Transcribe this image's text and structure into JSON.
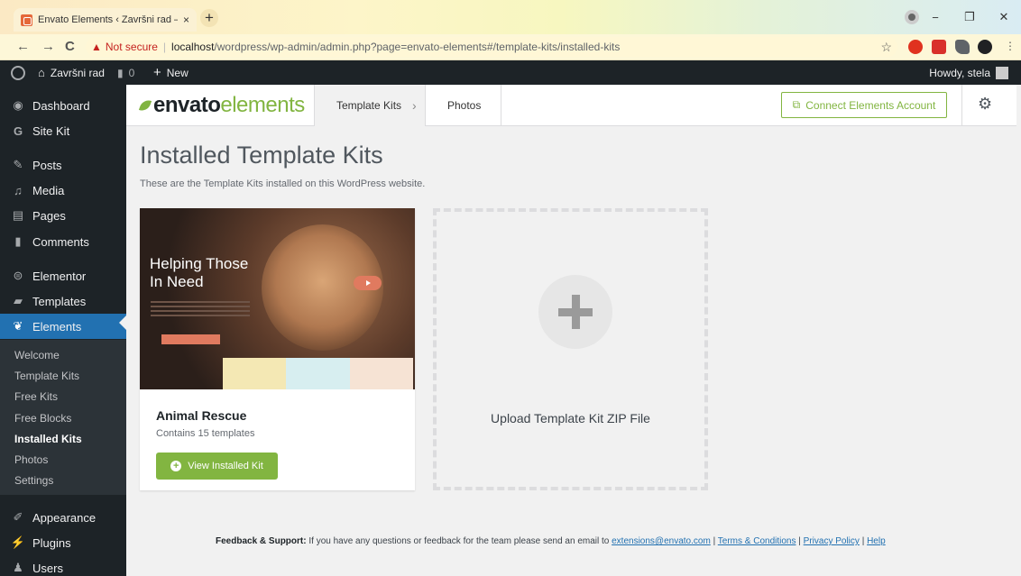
{
  "browser": {
    "tab_title": "Envato Elements ‹ Završni rad —",
    "tab_close": "×",
    "new_tab": "+",
    "window_buttons": [
      "−",
      "❐",
      "✕"
    ],
    "nav": {
      "back": "←",
      "forward": "→",
      "reload": "C"
    },
    "address": {
      "warning": "▲",
      "not_secure": "Not secure",
      "sep": "|",
      "host": "localhost",
      "path": "/wordpress/wp-admin/admin.php?page=envato-elements#/template-kits/installed-kits"
    },
    "bookmark_star": "☆"
  },
  "adminbar": {
    "site_name": "Završni rad",
    "comments_count": "0",
    "new_label": "New",
    "howdy": "Howdy, stela"
  },
  "sidebar": {
    "items": [
      {
        "label": "Dashboard",
        "icon": "dashboard-icon"
      },
      {
        "label": "Site Kit",
        "icon": "sitekit-icon"
      },
      {
        "label": "Posts",
        "icon": "pin-icon"
      },
      {
        "label": "Media",
        "icon": "media-icon"
      },
      {
        "label": "Pages",
        "icon": "pages-icon"
      },
      {
        "label": "Comments",
        "icon": "comment-icon"
      },
      {
        "label": "Elementor",
        "icon": "elementor-icon"
      },
      {
        "label": "Templates",
        "icon": "folder-icon"
      },
      {
        "label": "Elements",
        "icon": "leaf-icon"
      },
      {
        "label": "Appearance",
        "icon": "brush-icon"
      },
      {
        "label": "Plugins",
        "icon": "plug-icon"
      },
      {
        "label": "Users",
        "icon": "user-icon"
      }
    ],
    "submenu": [
      "Welcome",
      "Template Kits",
      "Free Kits",
      "Free Blocks",
      "Installed Kits",
      "Photos",
      "Settings"
    ]
  },
  "envato": {
    "logo_bold": "envato",
    "logo_light": "elements",
    "tab_template_kits": "Template Kits",
    "tab_chevron": "›",
    "tab_photos": "Photos",
    "connect_label": "Connect Elements Account",
    "accent": "#82b541"
  },
  "main": {
    "title": "Installed Template Kits",
    "description": "These are the Template Kits installed on this WordPress website.",
    "kit": {
      "name": "Animal Rescue",
      "count": "Contains 15 templates",
      "button": "View Installed Kit",
      "thumb_title_1": "Helping Those",
      "thumb_title_2": "In Need"
    },
    "upload_label": "Upload Template Kit ZIP File"
  },
  "footer": {
    "lead": "Feedback & Support:",
    "text": "If you have any questions or feedback for the team please send an email to",
    "email": "extensions@envato.com",
    "sep": "|",
    "terms": "Terms & Conditions",
    "privacy": "Privacy Policy",
    "help": "Help"
  }
}
